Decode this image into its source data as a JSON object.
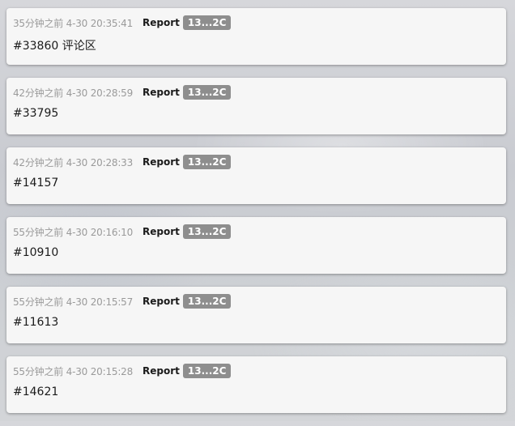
{
  "posts": [
    {
      "time": "35分钟之前 4-30 20:35:41",
      "report": "Report",
      "badge": "13...2C",
      "content": "#33860 评论区"
    },
    {
      "time": "42分钟之前 4-30 20:28:59",
      "report": "Report",
      "badge": "13...2C",
      "content": "#33795"
    },
    {
      "time": "42分钟之前 4-30 20:28:33",
      "report": "Report",
      "badge": "13...2C",
      "content": "#14157"
    },
    {
      "time": "55分钟之前 4-30 20:16:10",
      "report": "Report",
      "badge": "13...2C",
      "content": "#10910"
    },
    {
      "time": "55分钟之前 4-30 20:15:57",
      "report": "Report",
      "badge": "13...2C",
      "content": "#11613"
    },
    {
      "time": "55分钟之前 4-30 20:15:28",
      "report": "Report",
      "badge": "13...2C",
      "content": "#14621"
    }
  ]
}
